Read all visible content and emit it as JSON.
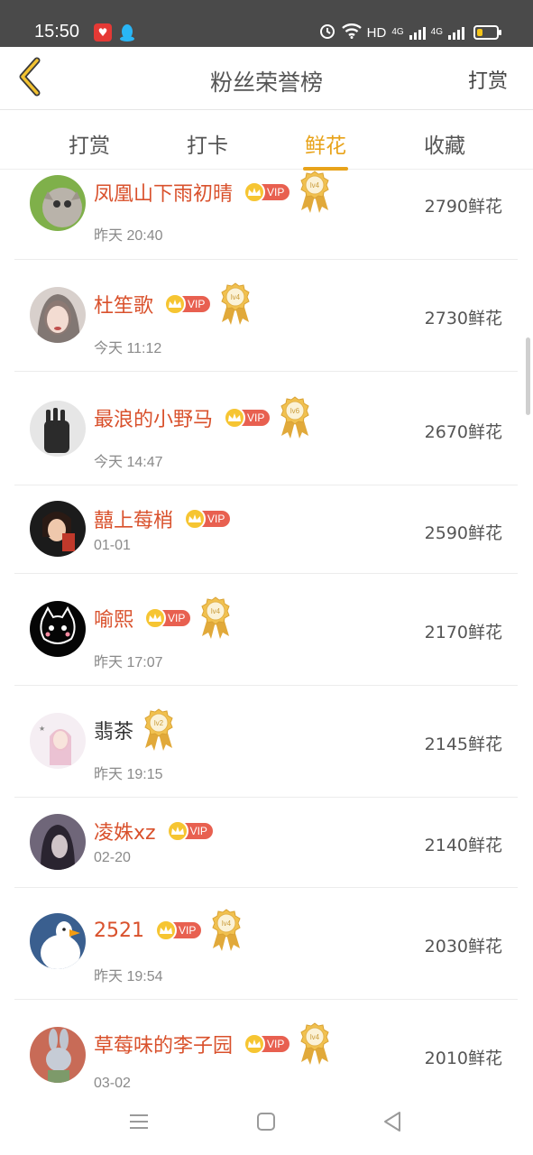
{
  "status_bar": {
    "time": "15:50",
    "hd_label": "HD",
    "net1": "4G",
    "net2": "4G",
    "battery_level": 0.3,
    "icons": [
      "alarm-icon",
      "wifi-icon",
      "signal-icon",
      "battery-icon"
    ]
  },
  "header": {
    "title": "粉丝荣誉榜",
    "action_label": "打赏",
    "back_icon": "chevron-left-icon"
  },
  "tabs": [
    {
      "label": "打赏",
      "active": false
    },
    {
      "label": "打卡",
      "active": false
    },
    {
      "label": "鲜花",
      "active": true
    },
    {
      "label": "收藏",
      "active": false
    }
  ],
  "vip_label": "VIP",
  "fans": [
    {
      "name": "凤凰山下雨初晴",
      "vip": true,
      "level": "lv4",
      "time": "昨天 20:40",
      "amount": "2790鲜花"
    },
    {
      "name": "杜笙歌",
      "vip": true,
      "level": "lv4",
      "time": "今天 11:12",
      "amount": "2730鲜花"
    },
    {
      "name": "最浪的小野马",
      "vip": true,
      "level": "lv6",
      "time": "今天 14:47",
      "amount": "2670鲜花"
    },
    {
      "name": "囍上莓梢",
      "vip": true,
      "level": "",
      "time": "01-01",
      "amount": "2590鲜花"
    },
    {
      "name": "喻熙",
      "vip": true,
      "level": "lv4",
      "time": "昨天 17:07",
      "amount": "2170鲜花"
    },
    {
      "name": "翡茶",
      "vip": false,
      "level": "lv2",
      "time": "昨天 19:15",
      "amount": "2145鲜花"
    },
    {
      "name": "凌姝xz",
      "vip": true,
      "level": "",
      "time": "02-20",
      "amount": "2140鲜花"
    },
    {
      "name": "2521",
      "vip": true,
      "level": "lv4",
      "time": "昨天 19:54",
      "amount": "2030鲜花"
    },
    {
      "name": "草莓味的李子园",
      "vip": true,
      "level": "lv4",
      "time": "03-02",
      "amount": "2010鲜花"
    }
  ],
  "colors": {
    "accent": "#e8a31a",
    "name_red": "#d9512c",
    "vip_tag": "#e86050"
  },
  "nav": [
    "menu-icon",
    "home-square-icon",
    "back-triangle-icon"
  ]
}
